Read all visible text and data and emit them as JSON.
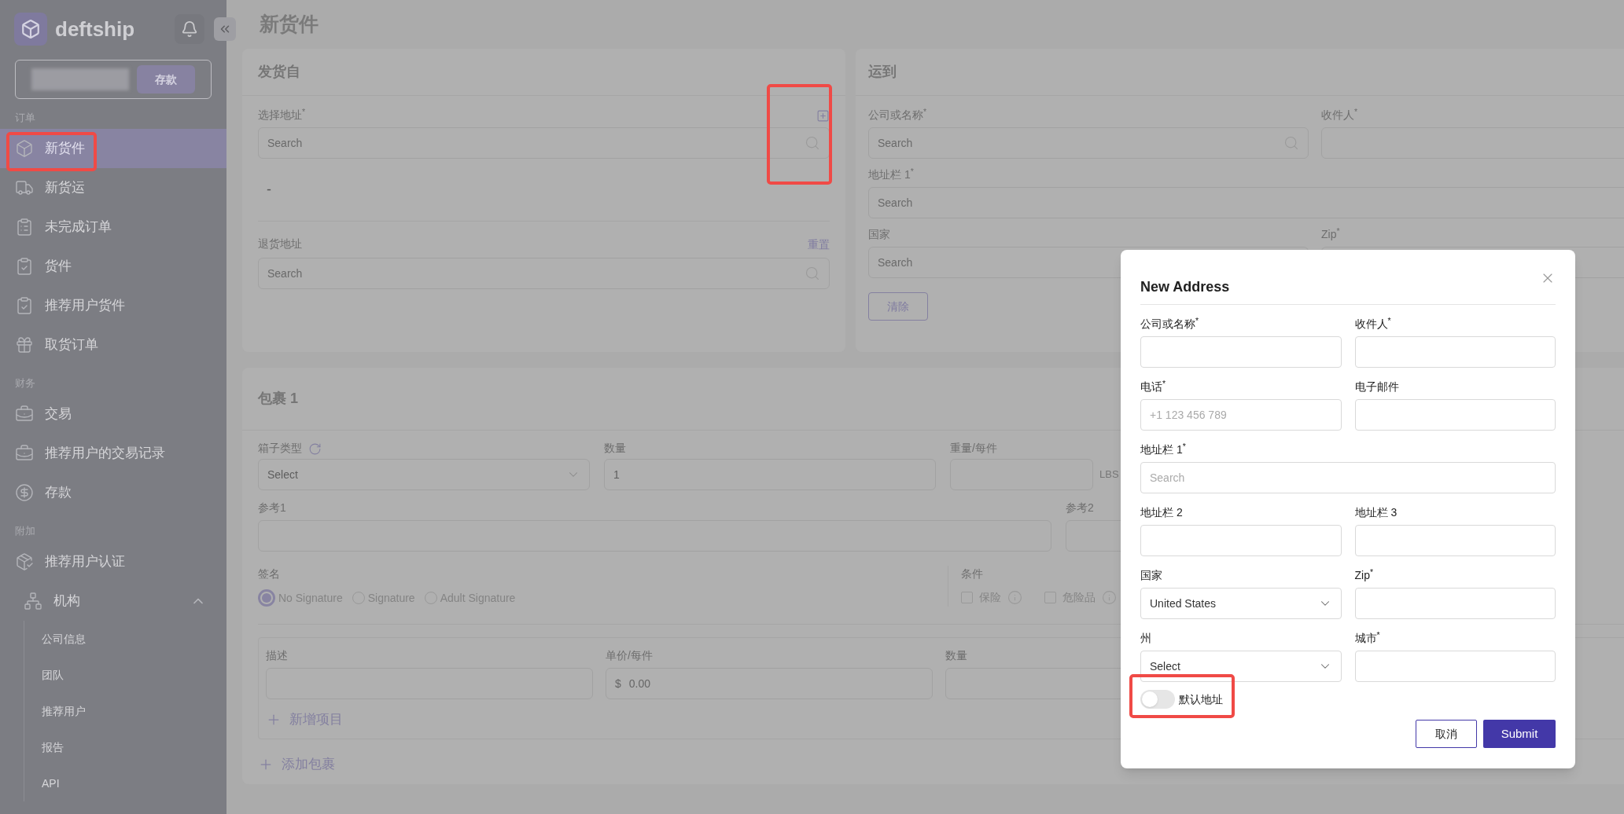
{
  "sidebar": {
    "brand": "deftship",
    "deposit_button": "存款",
    "sections": [
      {
        "title": "订单",
        "items": [
          {
            "label": "新货件",
            "selected": true
          },
          {
            "label": "新货运",
            "selected": false
          },
          {
            "label": "未完成订单",
            "selected": false
          },
          {
            "label": "货件",
            "selected": false
          },
          {
            "label": "推荐用户货件",
            "selected": false
          },
          {
            "label": "取货订单",
            "selected": false
          }
        ]
      },
      {
        "title": "财务",
        "items": [
          {
            "label": "交易",
            "selected": false
          },
          {
            "label": "推荐用户的交易记录",
            "selected": false
          },
          {
            "label": "存款",
            "selected": false
          }
        ]
      },
      {
        "title": "附加",
        "items": [
          {
            "label": "推荐用户认证",
            "selected": false
          },
          {
            "label": "机构",
            "selected": false,
            "expanded": true,
            "children": [
              {
                "label": "公司信息"
              },
              {
                "label": "团队"
              },
              {
                "label": "推荐用户"
              },
              {
                "label": "报告"
              },
              {
                "label": "API"
              }
            ]
          }
        ]
      }
    ]
  },
  "page_title": "新货件",
  "ship_from": {
    "title": "发货自",
    "address_label": "选择地址$^{*}$",
    "address_placeholder": "Search",
    "address_text": "-",
    "return_label": "退货地址",
    "reset_link": "重置",
    "return_placeholder": "Search"
  },
  "ship_to": {
    "title": "运到",
    "rows": [
      [
        {
          "label": "公司或名称$^{*}$",
          "kind": "search",
          "placeholder": "Search"
        },
        {
          "label": "收件人$^{*}$",
          "kind": "text"
        }
      ],
      [
        {
          "label": "地址栏 1$^{*}$",
          "kind": "text",
          "placeholder": "Search"
        }
      ],
      [
        {
          "label": "国家",
          "kind": "text",
          "placeholder": "Search"
        },
        {
          "label": "Zip$^{*}$",
          "kind": "text"
        }
      ]
    ],
    "clear_button": "清除"
  },
  "package": {
    "title": "包裹 1",
    "box_type_label": "箱子类型",
    "box_type_value": "Select",
    "quantity_label": "数量",
    "quantity_value": "1",
    "weight_label": "重量/每件",
    "weight_unit": "LBS",
    "ref1_label": "参考1",
    "ref2_label": "参考2",
    "signature_label": "签名",
    "signature_options": [
      {
        "label": "No Signature",
        "selected": true
      },
      {
        "label": "Signature",
        "selected": false
      },
      {
        "label": "Adult Signature",
        "selected": false
      }
    ],
    "conditions_label": "条件",
    "conditions": [
      {
        "label": "保险",
        "checked": false
      },
      {
        "label": "危险品",
        "checked": false
      }
    ],
    "item_columns": [
      {
        "label": "描述"
      },
      {
        "label": "单价/每件",
        "prefix": "$",
        "placeholder": "0.00"
      },
      {
        "label": "数量"
      }
    ],
    "add_item": "新增项目",
    "add_package": "添加包裹"
  },
  "modal": {
    "title": "New Address",
    "rows": [
      [
        {
          "label": "公司或名称$^{*}$",
          "kind": "text"
        },
        {
          "label": "收件人$^{*}$",
          "kind": "text"
        }
      ],
      [
        {
          "label": "电话$^{*}$",
          "kind": "text",
          "placeholder": "+1 123 456 789"
        },
        {
          "label": "电子邮件",
          "kind": "text"
        }
      ],
      [
        {
          "label": "地址栏 1$^{*}$",
          "kind": "text",
          "placeholder": "Search"
        }
      ],
      [
        {
          "label": "地址栏 2",
          "kind": "text"
        },
        {
          "label": "地址栏 3",
          "kind": "text"
        }
      ],
      [
        {
          "label": "国家",
          "kind": "select",
          "value": "United States"
        },
        {
          "label": "Zip$^{*}$",
          "kind": "text"
        }
      ],
      [
        {
          "label": "州",
          "kind": "select",
          "value": "Select"
        },
        {
          "label": "城市$^{*}$",
          "kind": "text"
        }
      ]
    ],
    "default_toggle": {
      "label": "默认地址",
      "on": false
    },
    "cancel_button": "取消",
    "submit_button": "Submit"
  }
}
